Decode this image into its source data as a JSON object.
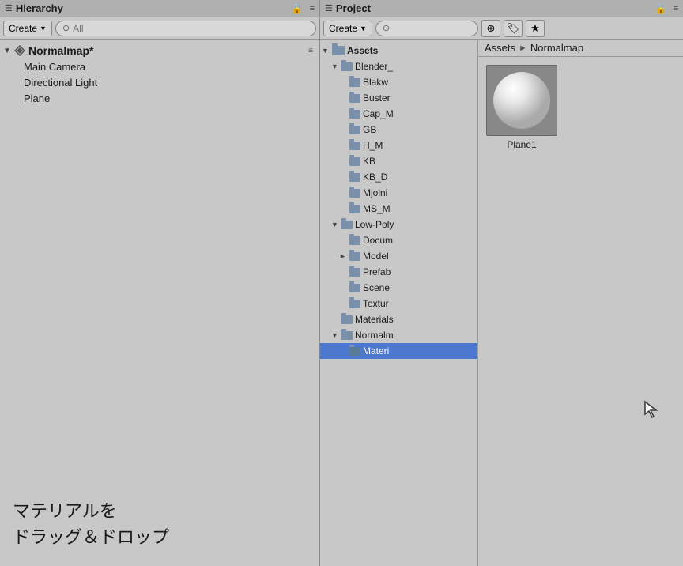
{
  "hierarchy": {
    "title": "Hierarchy",
    "create_label": "Create",
    "search_placeholder": "All",
    "scene_name": "Normalmap*",
    "items": [
      {
        "label": "Main Camera",
        "type": "child"
      },
      {
        "label": "Directional Light",
        "type": "child"
      },
      {
        "label": "Plane",
        "type": "child"
      }
    ]
  },
  "project": {
    "title": "Project",
    "create_label": "Create",
    "breadcrumb_root": "Assets",
    "breadcrumb_arrow": "►",
    "breadcrumb_sub": "Normalmap",
    "tree": [
      {
        "label": "Assets",
        "indent": 0,
        "expanded": true,
        "type": "folder"
      },
      {
        "label": "Blender_",
        "indent": 1,
        "expanded": true,
        "type": "folder"
      },
      {
        "label": "Blakw",
        "indent": 2,
        "expanded": false,
        "type": "folder"
      },
      {
        "label": "Buster",
        "indent": 2,
        "expanded": false,
        "type": "folder"
      },
      {
        "label": "Cap_M",
        "indent": 2,
        "expanded": false,
        "type": "folder"
      },
      {
        "label": "GB",
        "indent": 2,
        "expanded": false,
        "type": "folder"
      },
      {
        "label": "H_M",
        "indent": 2,
        "expanded": false,
        "type": "folder"
      },
      {
        "label": "KB",
        "indent": 2,
        "expanded": false,
        "type": "folder"
      },
      {
        "label": "KB_D",
        "indent": 2,
        "expanded": false,
        "type": "folder"
      },
      {
        "label": "Mjolni",
        "indent": 2,
        "expanded": false,
        "type": "folder"
      },
      {
        "label": "MS_M",
        "indent": 2,
        "expanded": false,
        "type": "folder"
      },
      {
        "label": "Low-Poly",
        "indent": 1,
        "expanded": true,
        "type": "folder"
      },
      {
        "label": "Docum",
        "indent": 2,
        "expanded": false,
        "type": "folder"
      },
      {
        "label": "Model",
        "indent": 2,
        "expanded": false,
        "type": "folder",
        "has_arrow": true
      },
      {
        "label": "Prefab",
        "indent": 2,
        "expanded": false,
        "type": "folder"
      },
      {
        "label": "Scene",
        "indent": 2,
        "expanded": false,
        "type": "folder"
      },
      {
        "label": "Textur",
        "indent": 2,
        "expanded": false,
        "type": "folder"
      },
      {
        "label": "Materials",
        "indent": 1,
        "expanded": false,
        "type": "folder"
      },
      {
        "label": "Normalm",
        "indent": 1,
        "expanded": true,
        "type": "folder"
      },
      {
        "label": "Materi",
        "indent": 2,
        "expanded": false,
        "type": "folder",
        "selected": true
      }
    ],
    "asset_item": {
      "name": "Plane1",
      "thumbnail_type": "sphere"
    }
  },
  "japanese_text": [
    "マテリアルを",
    "ドラッグ＆ドロップ"
  ],
  "icons": {
    "hamburger": "≡",
    "lock": "🔒",
    "search": "🔍",
    "arrow_right": "►",
    "arrow_down": "▼",
    "arrow_expand": "►"
  }
}
